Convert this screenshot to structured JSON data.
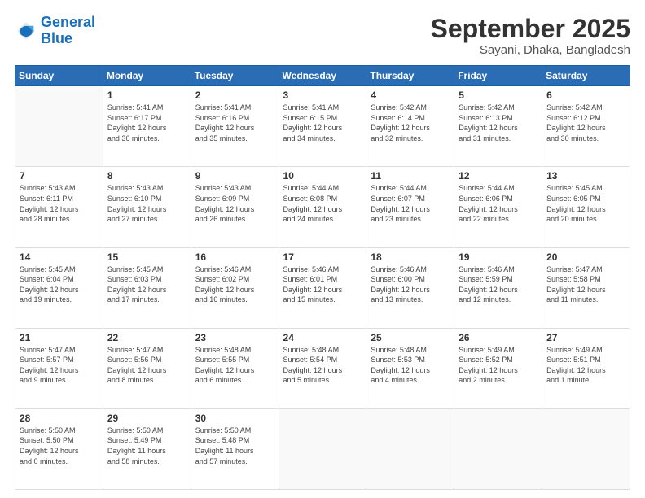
{
  "logo": {
    "line1": "General",
    "line2": "Blue"
  },
  "header": {
    "month_year": "September 2025",
    "location": "Sayani, Dhaka, Bangladesh"
  },
  "days": [
    "Sunday",
    "Monday",
    "Tuesday",
    "Wednesday",
    "Thursday",
    "Friday",
    "Saturday"
  ],
  "weeks": [
    [
      {
        "day": "",
        "content": ""
      },
      {
        "day": "1",
        "content": "Sunrise: 5:41 AM\nSunset: 6:17 PM\nDaylight: 12 hours\nand 36 minutes."
      },
      {
        "day": "2",
        "content": "Sunrise: 5:41 AM\nSunset: 6:16 PM\nDaylight: 12 hours\nand 35 minutes."
      },
      {
        "day": "3",
        "content": "Sunrise: 5:41 AM\nSunset: 6:15 PM\nDaylight: 12 hours\nand 34 minutes."
      },
      {
        "day": "4",
        "content": "Sunrise: 5:42 AM\nSunset: 6:14 PM\nDaylight: 12 hours\nand 32 minutes."
      },
      {
        "day": "5",
        "content": "Sunrise: 5:42 AM\nSunset: 6:13 PM\nDaylight: 12 hours\nand 31 minutes."
      },
      {
        "day": "6",
        "content": "Sunrise: 5:42 AM\nSunset: 6:12 PM\nDaylight: 12 hours\nand 30 minutes."
      }
    ],
    [
      {
        "day": "7",
        "content": "Sunrise: 5:43 AM\nSunset: 6:11 PM\nDaylight: 12 hours\nand 28 minutes."
      },
      {
        "day": "8",
        "content": "Sunrise: 5:43 AM\nSunset: 6:10 PM\nDaylight: 12 hours\nand 27 minutes."
      },
      {
        "day": "9",
        "content": "Sunrise: 5:43 AM\nSunset: 6:09 PM\nDaylight: 12 hours\nand 26 minutes."
      },
      {
        "day": "10",
        "content": "Sunrise: 5:44 AM\nSunset: 6:08 PM\nDaylight: 12 hours\nand 24 minutes."
      },
      {
        "day": "11",
        "content": "Sunrise: 5:44 AM\nSunset: 6:07 PM\nDaylight: 12 hours\nand 23 minutes."
      },
      {
        "day": "12",
        "content": "Sunrise: 5:44 AM\nSunset: 6:06 PM\nDaylight: 12 hours\nand 22 minutes."
      },
      {
        "day": "13",
        "content": "Sunrise: 5:45 AM\nSunset: 6:05 PM\nDaylight: 12 hours\nand 20 minutes."
      }
    ],
    [
      {
        "day": "14",
        "content": "Sunrise: 5:45 AM\nSunset: 6:04 PM\nDaylight: 12 hours\nand 19 minutes."
      },
      {
        "day": "15",
        "content": "Sunrise: 5:45 AM\nSunset: 6:03 PM\nDaylight: 12 hours\nand 17 minutes."
      },
      {
        "day": "16",
        "content": "Sunrise: 5:46 AM\nSunset: 6:02 PM\nDaylight: 12 hours\nand 16 minutes."
      },
      {
        "day": "17",
        "content": "Sunrise: 5:46 AM\nSunset: 6:01 PM\nDaylight: 12 hours\nand 15 minutes."
      },
      {
        "day": "18",
        "content": "Sunrise: 5:46 AM\nSunset: 6:00 PM\nDaylight: 12 hours\nand 13 minutes."
      },
      {
        "day": "19",
        "content": "Sunrise: 5:46 AM\nSunset: 5:59 PM\nDaylight: 12 hours\nand 12 minutes."
      },
      {
        "day": "20",
        "content": "Sunrise: 5:47 AM\nSunset: 5:58 PM\nDaylight: 12 hours\nand 11 minutes."
      }
    ],
    [
      {
        "day": "21",
        "content": "Sunrise: 5:47 AM\nSunset: 5:57 PM\nDaylight: 12 hours\nand 9 minutes."
      },
      {
        "day": "22",
        "content": "Sunrise: 5:47 AM\nSunset: 5:56 PM\nDaylight: 12 hours\nand 8 minutes."
      },
      {
        "day": "23",
        "content": "Sunrise: 5:48 AM\nSunset: 5:55 PM\nDaylight: 12 hours\nand 6 minutes."
      },
      {
        "day": "24",
        "content": "Sunrise: 5:48 AM\nSunset: 5:54 PM\nDaylight: 12 hours\nand 5 minutes."
      },
      {
        "day": "25",
        "content": "Sunrise: 5:48 AM\nSunset: 5:53 PM\nDaylight: 12 hours\nand 4 minutes."
      },
      {
        "day": "26",
        "content": "Sunrise: 5:49 AM\nSunset: 5:52 PM\nDaylight: 12 hours\nand 2 minutes."
      },
      {
        "day": "27",
        "content": "Sunrise: 5:49 AM\nSunset: 5:51 PM\nDaylight: 12 hours\nand 1 minute."
      }
    ],
    [
      {
        "day": "28",
        "content": "Sunrise: 5:50 AM\nSunset: 5:50 PM\nDaylight: 12 hours\nand 0 minutes."
      },
      {
        "day": "29",
        "content": "Sunrise: 5:50 AM\nSunset: 5:49 PM\nDaylight: 11 hours\nand 58 minutes."
      },
      {
        "day": "30",
        "content": "Sunrise: 5:50 AM\nSunset: 5:48 PM\nDaylight: 11 hours\nand 57 minutes."
      },
      {
        "day": "",
        "content": ""
      },
      {
        "day": "",
        "content": ""
      },
      {
        "day": "",
        "content": ""
      },
      {
        "day": "",
        "content": ""
      }
    ]
  ]
}
